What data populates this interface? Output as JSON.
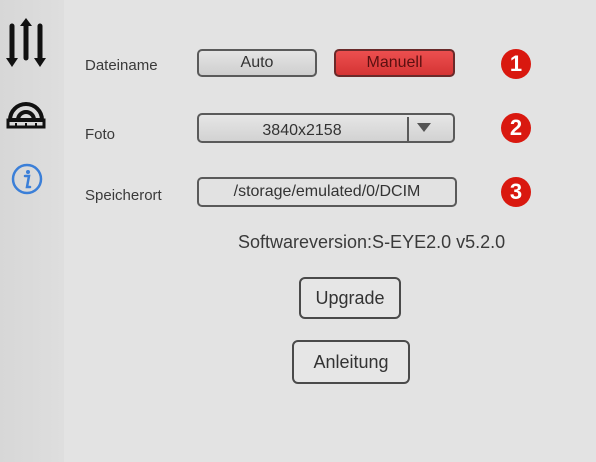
{
  "sidebar": {
    "items": [
      {
        "icon": "sliders-icon",
        "label": ""
      },
      {
        "icon": "protractor-icon",
        "label": ""
      },
      {
        "icon": "info-icon",
        "label": ""
      }
    ]
  },
  "settings": {
    "filename": {
      "label": "Dateiname",
      "options": [
        "Auto",
        "Manuell"
      ],
      "selected": "Manuell",
      "badge": "1"
    },
    "photo": {
      "label": "Foto",
      "resolution": "3840x2158",
      "badge": "2"
    },
    "storage": {
      "label": "Speicherort",
      "path": "/storage/emulated/0/DCIM",
      "badge": "3"
    }
  },
  "software_version": "Softwareversion:S-EYE2.0 v5.2.0",
  "buttons": {
    "upgrade": "Upgrade",
    "manual": "Anleitung"
  },
  "colors": {
    "active_button": "#e04040",
    "badge": "#d9180f",
    "info_icon": "#3b7fd8"
  }
}
